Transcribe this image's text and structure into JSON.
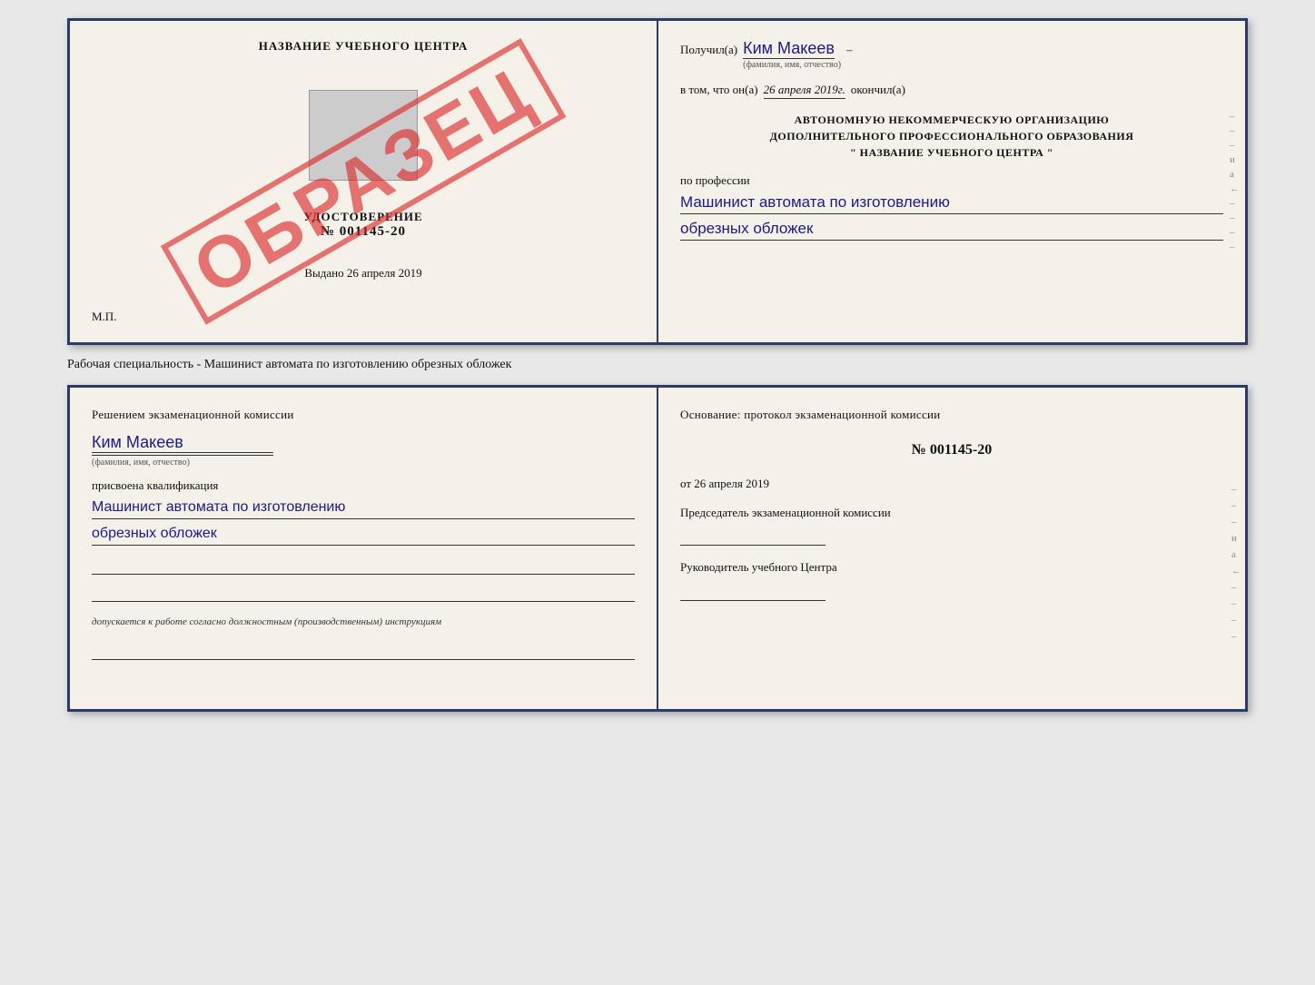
{
  "topDoc": {
    "left": {
      "schoolName": "НАЗВАНИЕ УЧЕБНОГО ЦЕНТРА",
      "watermark": "ОБРАЗЕЦ",
      "udostoverenie": "УДОСТОВЕРЕНИЕ",
      "number": "№ 001145-20",
      "vydano": "Выдано",
      "vydanoDate": "26 апреля 2019",
      "mp": "М.П."
    },
    "right": {
      "recipientLabel": "Получил(а)",
      "recipientName": "Ким Макеев",
      "fioSub": "(фамилия, имя, отчество)",
      "vTomChto": "в том, что он(а)",
      "date": "26 апреля 2019г.",
      "okonchil": "окончил(а)",
      "orgLine1": "АВТОНОМНУЮ НЕКОММЕРЧЕСКУЮ ОРГАНИЗАЦИЮ",
      "orgLine2": "ДОПОЛНИТЕЛЬНОГО ПРОФЕССИОНАЛЬНОГО ОБРАЗОВАНИЯ",
      "orgLine3": "\"   НАЗВАНИЕ УЧЕБНОГО ЦЕНТРА   \"",
      "poProfessii": "по профессии",
      "profValue1": "Машинист автомата по изготовлению",
      "profValue2": "обрезных обложек"
    }
  },
  "specialtyLabel": "Рабочая специальность - Машинист автомата по изготовлению обрезных обложек",
  "bottomDoc": {
    "left": {
      "commissionTitle": "Решением экзаменационной комиссии",
      "personName": "Ким Макеев",
      "fioSub": "(фамилия, имя, отчество)",
      "assignedQual": "присвоена квалификация",
      "qualValue1": "Машинист автомата по изготовлению",
      "qualValue2": "обрезных обложек",
      "допускается": "допускается к работе согласно должностным (производственным) инструкциям"
    },
    "right": {
      "osnование": "Основание: протокол экзаменационной комиссии",
      "protocolNumber": "№  001145-20",
      "ot": "от",
      "protocolDate": "26 апреля 2019",
      "chairman": "Председатель экзаменационной комиссии",
      "director": "Руководитель учебного Центра"
    }
  },
  "dashes": [
    "-",
    "-",
    "-",
    "и",
    "а",
    "←",
    "-",
    "-",
    "-",
    "-"
  ]
}
